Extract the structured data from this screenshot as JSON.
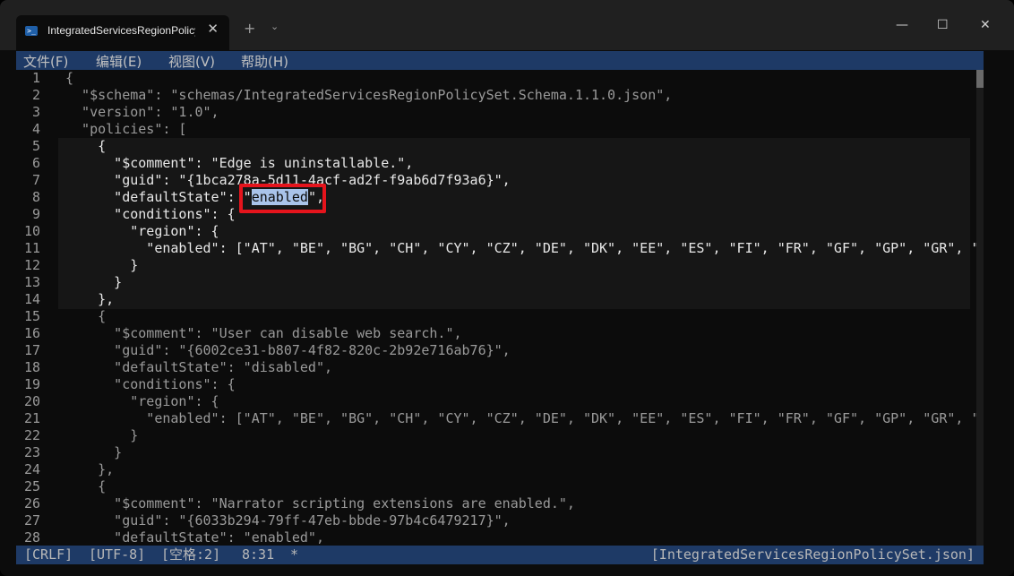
{
  "window": {
    "tab_title": "IntegratedServicesRegionPolicySet.json",
    "tab_icon_glyph": ">_",
    "controls": {
      "newtab": "+",
      "dropdown": "⌄",
      "minimize": "—",
      "maximize": "☐",
      "close": "✕",
      "tab_close": "✕"
    }
  },
  "menu": [
    {
      "label": "文件(F)"
    },
    {
      "label": "编辑(E)"
    },
    {
      "label": "视图(V)"
    },
    {
      "label": "帮助(H)"
    }
  ],
  "editor": {
    "active_line": 8,
    "cursor": "8:31",
    "selected_text": "enabled",
    "lines": [
      {
        "n": "1",
        "text": "{"
      },
      {
        "n": "2",
        "text": "  \"$schema\": \"schemas/IntegratedServicesRegionPolicySet.Schema.1.1.0.json\","
      },
      {
        "n": "3",
        "text": "  \"version\": \"1.0\","
      },
      {
        "n": "4",
        "text": "  \"policies\": ["
      },
      {
        "n": "5",
        "text": "    {"
      },
      {
        "n": "6",
        "text": "      \"$comment\": \"Edge is uninstallable.\","
      },
      {
        "n": "7",
        "text": "      \"guid\": \"{1bca278a-5d11-4acf-ad2f-f9ab6d7f93a6}\","
      },
      {
        "n": "8",
        "pre": "      \"defaultState\": \"",
        "sel": "enabled",
        "post": "\","
      },
      {
        "n": "9",
        "text": "      \"conditions\": {"
      },
      {
        "n": "10",
        "text": "        \"region\": {"
      },
      {
        "n": "11",
        "text": "          \"enabled\": [\"AT\", \"BE\", \"BG\", \"CH\", \"CY\", \"CZ\", \"DE\", \"DK\", \"EE\", \"ES\", \"FI\", \"FR\", \"GF\", \"GP\", \"GR\", \""
      },
      {
        "n": "12",
        "text": "        }"
      },
      {
        "n": "13",
        "text": "      }"
      },
      {
        "n": "14",
        "text": "    },"
      },
      {
        "n": "15",
        "text": "    {"
      },
      {
        "n": "16",
        "text": "      \"$comment\": \"User can disable web search.\","
      },
      {
        "n": "17",
        "text": "      \"guid\": \"{6002ce31-b807-4f82-820c-2b92e716ab76}\","
      },
      {
        "n": "18",
        "text": "      \"defaultState\": \"disabled\","
      },
      {
        "n": "19",
        "text": "      \"conditions\": {"
      },
      {
        "n": "20",
        "text": "        \"region\": {"
      },
      {
        "n": "21",
        "text": "          \"enabled\": [\"AT\", \"BE\", \"BG\", \"CH\", \"CY\", \"CZ\", \"DE\", \"DK\", \"EE\", \"ES\", \"FI\", \"FR\", \"GF\", \"GP\", \"GR\", \""
      },
      {
        "n": "22",
        "text": "        }"
      },
      {
        "n": "23",
        "text": "      }"
      },
      {
        "n": "24",
        "text": "    },"
      },
      {
        "n": "25",
        "text": "    {"
      },
      {
        "n": "26",
        "text": "      \"$comment\": \"Narrator scripting extensions are enabled.\","
      },
      {
        "n": "27",
        "text": "      \"guid\": \"{6033b294-79ff-47eb-bbde-97b4c6479217}\","
      },
      {
        "n": "28",
        "text": "      \"defaultState\": \"enabled\","
      }
    ]
  },
  "status": {
    "line_ending": "[CRLF]",
    "encoding": "[UTF-8]",
    "indent": "[空格:2]",
    "position": "8:31",
    "modified": "*",
    "filename": "[IntegratedServicesRegionPolicySet.json]"
  },
  "colors": {
    "menu_bg": "#1e3a66",
    "selection": "#a9c3ea",
    "highlight_box": "#e5141c"
  }
}
